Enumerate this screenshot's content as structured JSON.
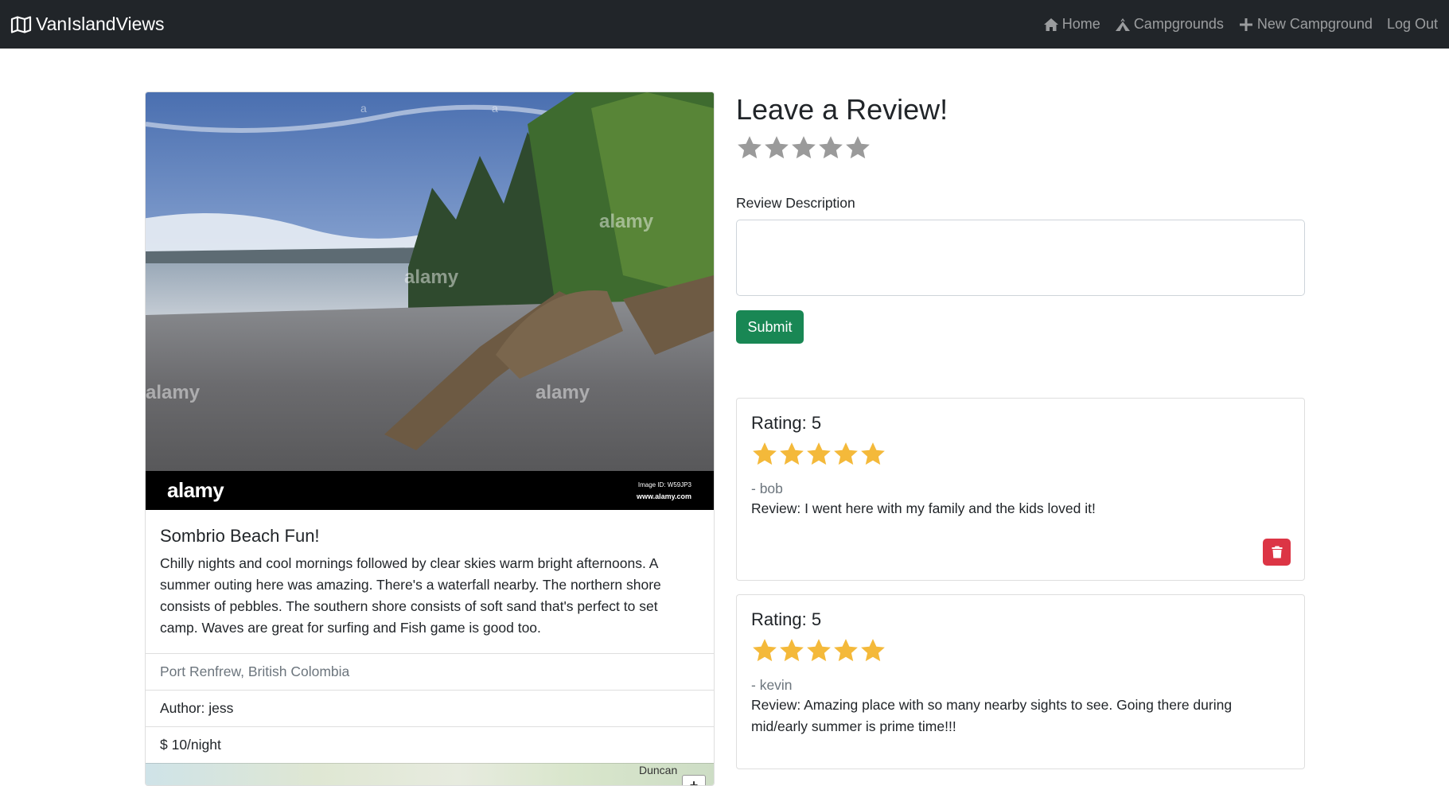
{
  "navbar": {
    "brand": "VanIslandViews",
    "brand_icon": "map-icon",
    "links": [
      {
        "label": "Home",
        "icon": "home-icon"
      },
      {
        "label": "Campgrounds",
        "icon": "campground-icon"
      },
      {
        "label": "New Campground",
        "icon": "plus-icon"
      },
      {
        "label": "Log Out"
      }
    ]
  },
  "campground": {
    "image_watermark": {
      "logo": "alamy",
      "image_id": "Image ID: W59JP3",
      "url": "www.alamy.com"
    },
    "title": "Sombrio Beach Fun!",
    "description": "Chilly nights and cool mornings followed by clear skies warm bright afternoons. A summer outing here was amazing. There's a waterfall nearby. The northern shore consists of pebbles. The southern shore consists of soft sand that's perfect to set camp. Waves are great for surfing and Fish game is good too.",
    "location": "Port Renfrew, British Colombia",
    "author": "Author: jess",
    "price": "$ 10/night",
    "map": {
      "city_label": "Duncan",
      "zoom_in": "+"
    }
  },
  "review_form": {
    "heading": "Leave a Review!",
    "star_rating_value": 0,
    "star_max": 5,
    "description_label": "Review Description",
    "description_value": "",
    "submit_label": "Submit"
  },
  "reviews": [
    {
      "rating_label": "Rating: 5",
      "rating": 5,
      "author": "- bob",
      "text": "Review: I went here with my family and the kids loved it!",
      "delete_icon": "trash-icon"
    },
    {
      "rating_label": "Rating: 5",
      "rating": 5,
      "author": "- kevin",
      "text": "Review: Amazing place with so many nearby sights to see. Going there during mid/early summer is prime time!!!"
    }
  ],
  "colors": {
    "navbar_bg": "#212529",
    "star_filled": "#f4b93a",
    "star_empty": "#9a9a9a",
    "submit_bg": "#198754",
    "delete_bg": "#dc3545"
  }
}
